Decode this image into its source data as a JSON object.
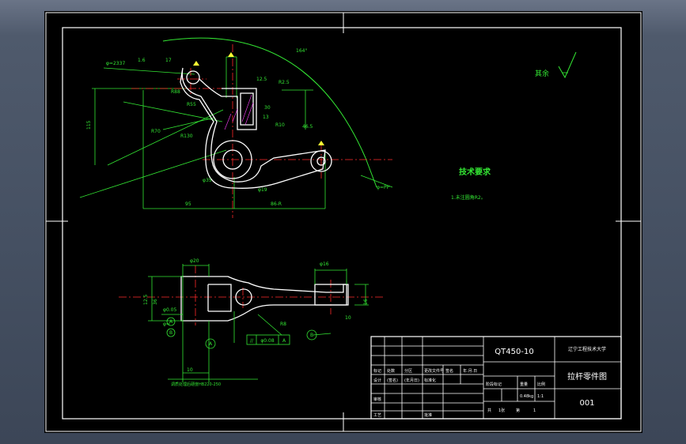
{
  "colors": {
    "green": "#33e633",
    "white": "#ffffff",
    "cyan": "#00e0e0",
    "red": "#ff2a2a",
    "yellow": "#ffff33",
    "magenta": "#e040e0",
    "olive": "#b0b020",
    "paper": "#000000"
  },
  "notes": {
    "tech_title": "技术要求",
    "tech_item": "1.未注圆角R2。",
    "surface_label": "其余"
  },
  "dims_top": {
    "d1": "φ=2337",
    "d2": "1.6",
    "d3": "17",
    "d4": "164°",
    "d5": "R88",
    "d6": "12.5",
    "d7": "R2.5",
    "d8": "R70",
    "d9": "R55",
    "d10": "R130",
    "d11": "13",
    "d12": "R10",
    "d13": "46.5",
    "d14": "φ35",
    "d15": "φ19",
    "d16": "95",
    "d17": "86-R",
    "d18": "φ=PP",
    "d19": "115",
    "d20": "30"
  },
  "dims_bottom": {
    "b1": "φ20",
    "b2": "φ16",
    "b3": "12.5",
    "b4": "36",
    "b5": "16",
    "b6": "R8",
    "b7": "10",
    "b8": "φ0.05",
    "b9": "A",
    "b10": "B",
    "b11": "A",
    "b12": "B",
    "b13": "φ=",
    "b14": "10"
  },
  "tolerance": {
    "sym": "//",
    "val": "φ0.08",
    "ref": "A"
  },
  "bottom_note": "调质处理后硬度HB220-250",
  "title_block": {
    "material": "QT450-10",
    "school": "辽宁工程技术大学",
    "part_name": "拉杆零件图",
    "drawing_no": "001",
    "r1": [
      "标记",
      "处数",
      "分区",
      "更改文件号",
      "签名",
      "年.月.日"
    ],
    "r2": [
      "设计",
      "(签名)",
      "(年月日)",
      "标准化"
    ],
    "r3": [
      "审核"
    ],
    "r4": [
      "工艺",
      "批准"
    ],
    "stage": "阶段标记",
    "weight": "重量",
    "scale": "比例",
    "wval": "0.48kg",
    "sval": "1:1",
    "sheets": [
      "共",
      "1张",
      "第",
      "1"
    ]
  }
}
